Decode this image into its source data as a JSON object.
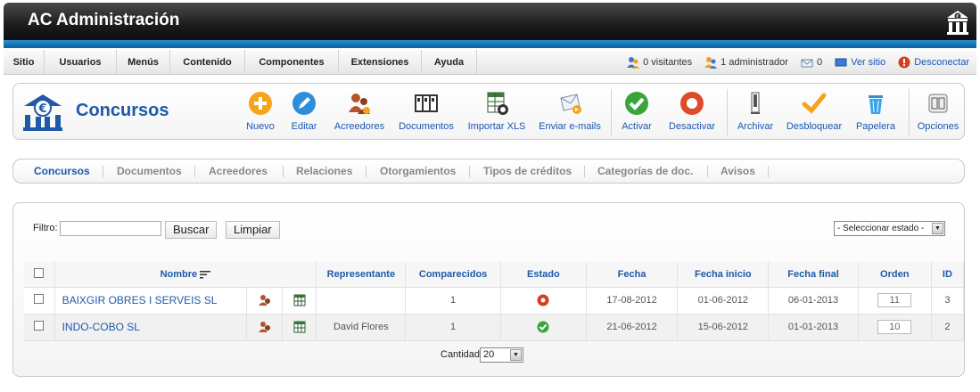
{
  "header": {
    "title": "AC Administración",
    "logo_icon": "euro-bank-icon"
  },
  "menu": {
    "items": [
      "Sitio",
      "Usuarios",
      "Menús",
      "Contenido",
      "Componentes",
      "Extensiones",
      "Ayuda"
    ],
    "status": {
      "visitors": "0 visitantes",
      "admins": "1 administrador",
      "messages": "0",
      "view_site": "Ver sitio",
      "logout": "Desconectar"
    }
  },
  "page": {
    "title": "Concursos",
    "icon": "euro-bank-icon"
  },
  "toolbar": {
    "nuevo": "Nuevo",
    "editar": "Editar",
    "acreedores": "Acreedores",
    "documentos": "Documentos",
    "importar": "Importar XLS",
    "enviar": "Enviar e-mails",
    "activar": "Activar",
    "desactivar": "Desactivar",
    "archivar": "Archivar",
    "desbloquear": "Desbloquear",
    "papelera": "Papelera",
    "opciones": "Opciones"
  },
  "submenu": {
    "concursos": "Concursos",
    "documentos": "Documentos",
    "acreedores": "Acreedores",
    "relaciones": "Relaciones",
    "otorgamientos": "Otorgamientos",
    "tipos": "Tipos de créditos",
    "categorias": "Categorías de doc.",
    "avisos": "Avisos"
  },
  "filter": {
    "label": "Filtro:",
    "value": "",
    "search_label": "Buscar",
    "clear_label": "Limpiar",
    "state_selected": "- Seleccionar estado -"
  },
  "table": {
    "headers": {
      "nombre": "Nombre",
      "representante": "Representante",
      "comparecidos": "Comparecidos",
      "estado": "Estado",
      "fecha": "Fecha",
      "fecha_inicio": "Fecha inicio",
      "fecha_final": "Fecha final",
      "orden": "Orden",
      "id": "ID"
    },
    "rows": [
      {
        "nombre": "BAIXGIR OBRES I SERVEIS SL",
        "representante": "",
        "comparecidos": "1",
        "estado": "inactive",
        "fecha": "17-08-2012",
        "fecha_inicio": "01-06-2012",
        "fecha_final": "06-01-2013",
        "orden": "11",
        "id": "3"
      },
      {
        "nombre": "INDO-COBO SL",
        "representante": "David Flores",
        "comparecidos": "1",
        "estado": "active",
        "fecha": "21-06-2012",
        "fecha_inicio": "15-06-2012",
        "fecha_final": "01-01-2013",
        "orden": "10",
        "id": "2"
      }
    ]
  },
  "pagination": {
    "label": "Cantidad",
    "value": "20"
  },
  "colors": {
    "brand_blue": "#1e5aa8",
    "active_green": "#3aa53a",
    "inactive_red": "#d2401f"
  }
}
